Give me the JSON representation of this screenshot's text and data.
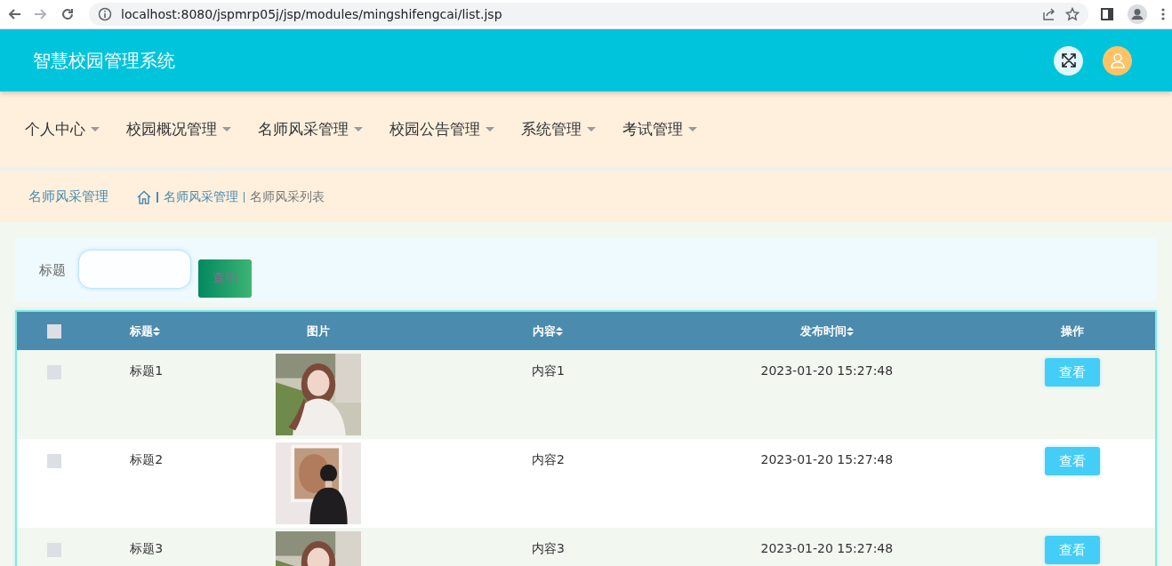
{
  "browser": {
    "url": "localhost:8080/jspmrp05j/jsp/modules/mingshifengcai/list.jsp"
  },
  "header": {
    "title": "智慧校园管理系统"
  },
  "nav": [
    {
      "label": "个人中心"
    },
    {
      "label": "校园概况管理"
    },
    {
      "label": "名师风采管理"
    },
    {
      "label": "校园公告管理"
    },
    {
      "label": "系统管理"
    },
    {
      "label": "考试管理"
    }
  ],
  "breadcrumb": {
    "title": "名师风采管理",
    "path": [
      "名师风采管理",
      "名师风采列表"
    ]
  },
  "search": {
    "label": "标题",
    "button": "查询"
  },
  "table": {
    "select_all_checked": false,
    "columns": [
      {
        "label": "标题",
        "sortable": true
      },
      {
        "label": "图片",
        "sortable": false
      },
      {
        "label": "内容",
        "sortable": true
      },
      {
        "label": "发布时间",
        "sortable": true
      },
      {
        "label": "操作",
        "sortable": false
      }
    ],
    "rows": [
      {
        "checked": false,
        "title": "标题1",
        "content": "内容1",
        "time": "2023-01-20 15:27:48",
        "action": "查看"
      },
      {
        "checked": false,
        "title": "标题2",
        "content": "内容2",
        "time": "2023-01-20 15:27:48",
        "action": "查看"
      },
      {
        "checked": false,
        "title": "标题3",
        "content": "内容3",
        "time": "2023-01-20 15:27:48",
        "action": "查看"
      }
    ]
  }
}
